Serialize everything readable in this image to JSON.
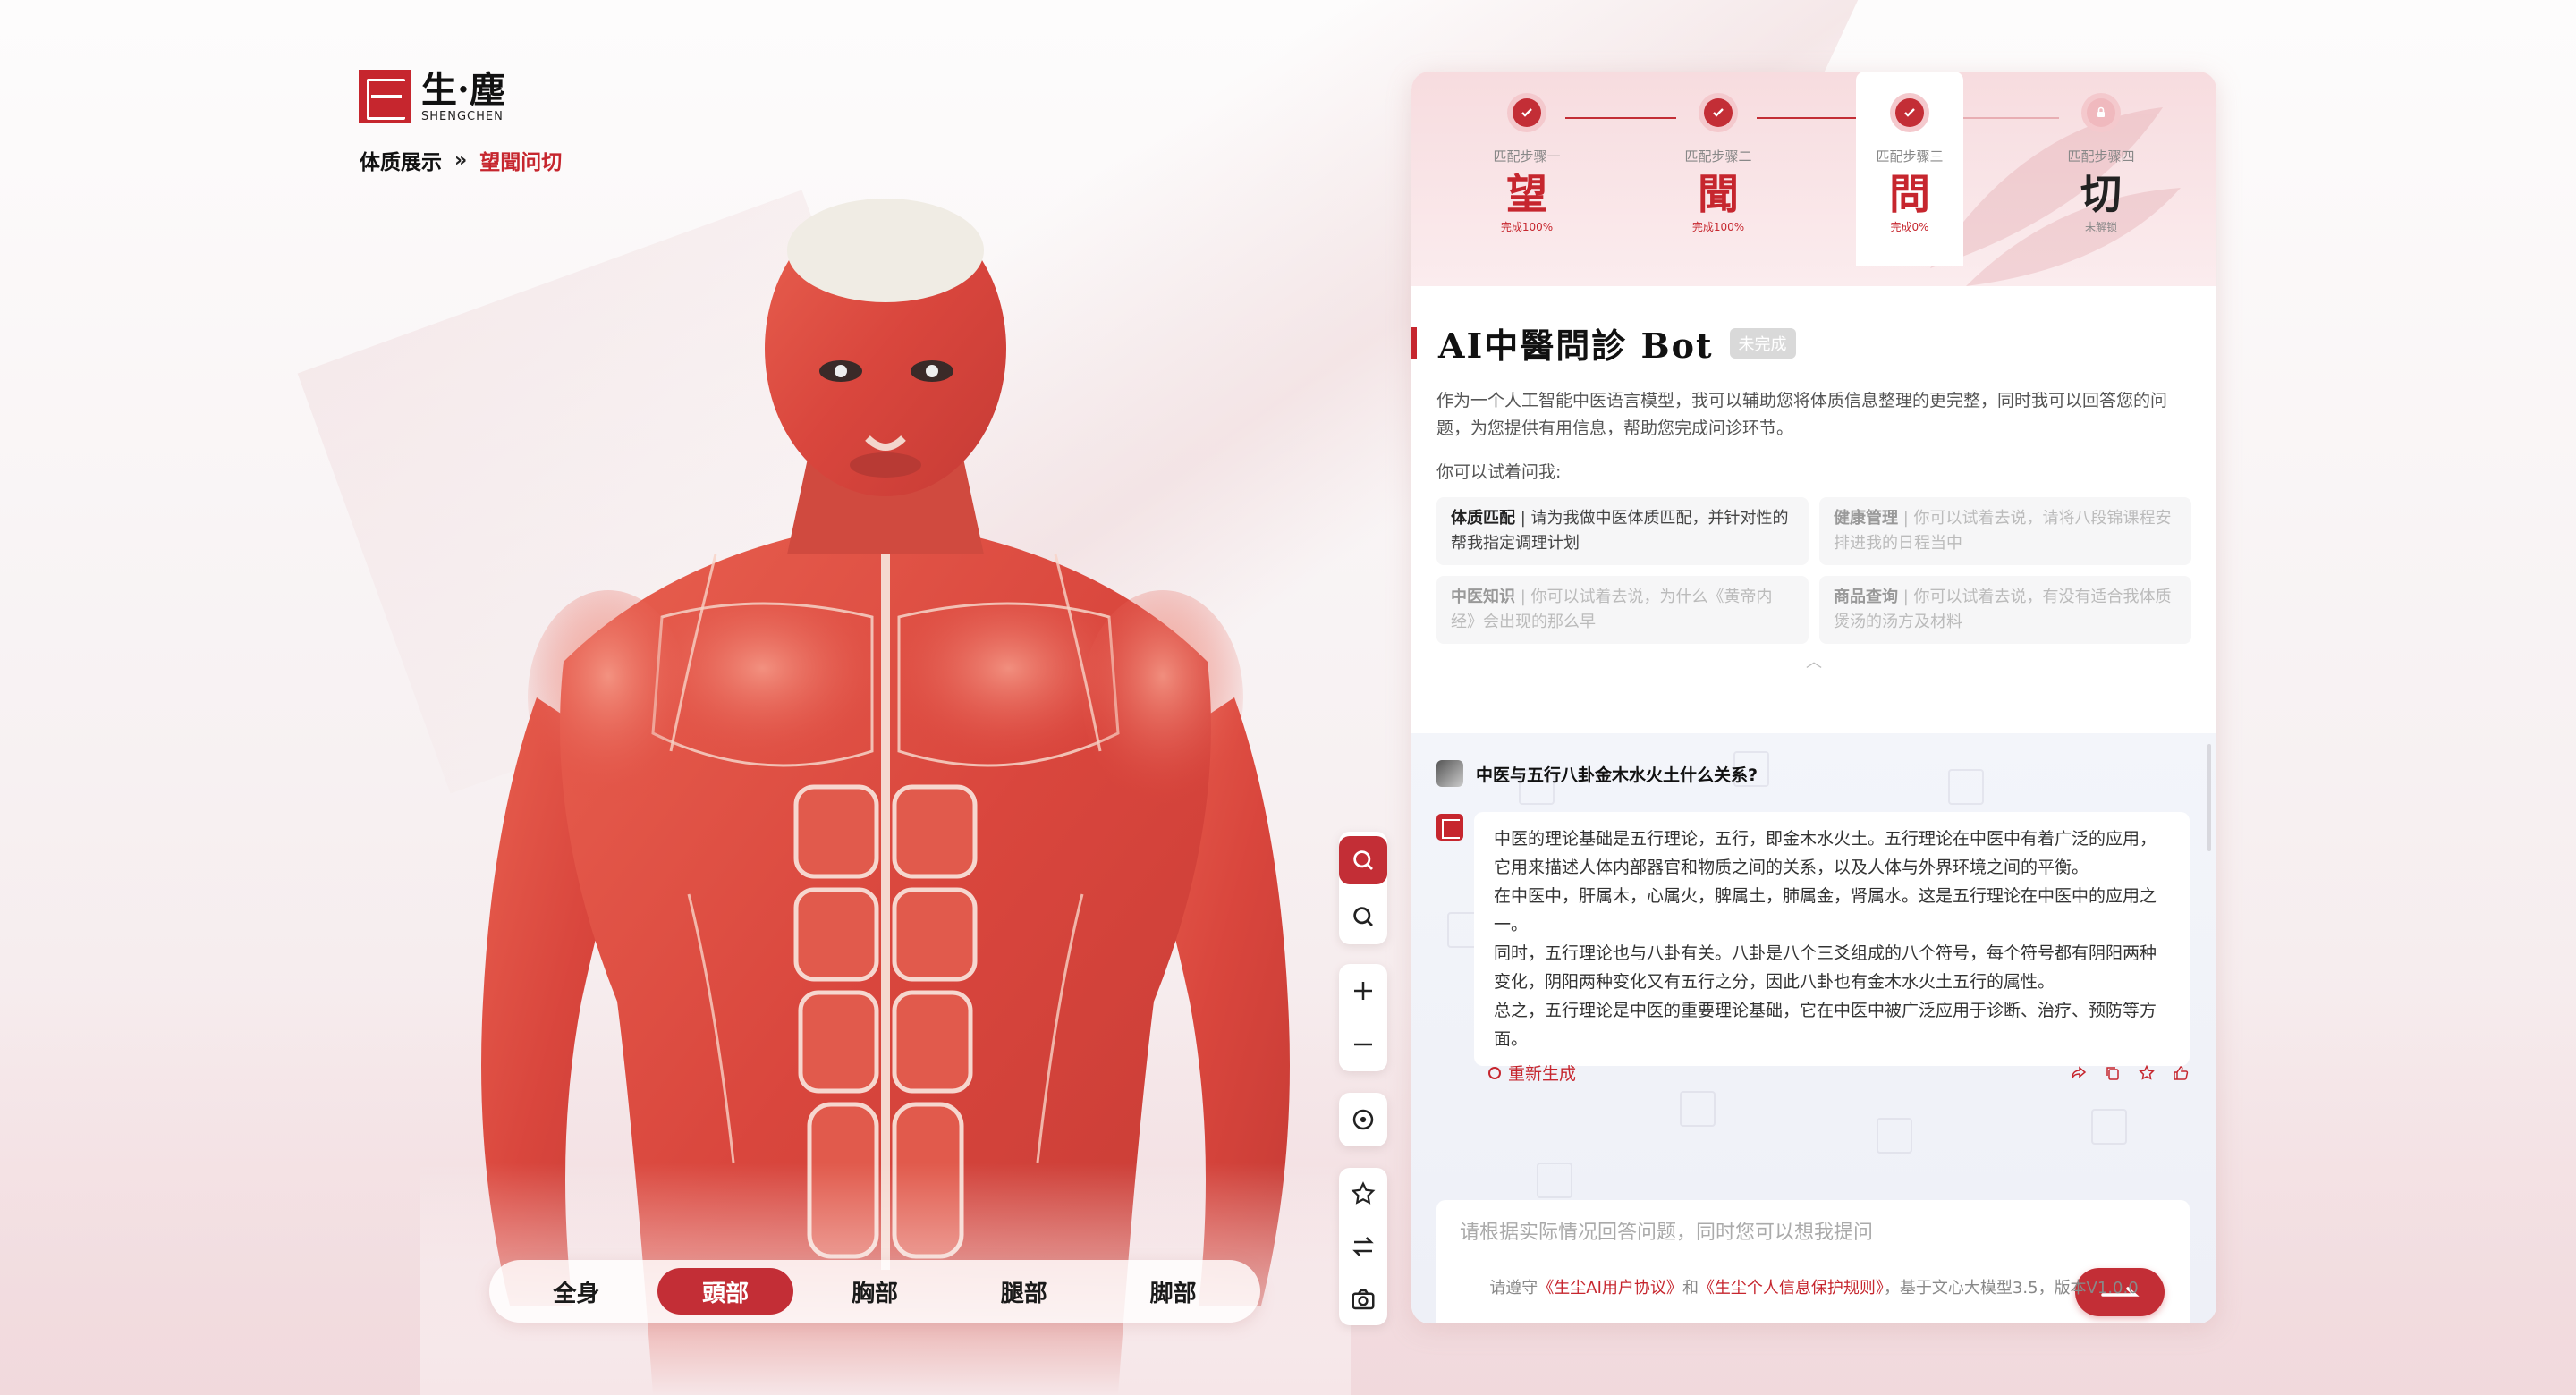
{
  "brand": {
    "name_cn": "生·塵",
    "name_en": "SHENGCHEN"
  },
  "breadcrumb": {
    "root": "体质展示",
    "separator": "»",
    "current": "望聞问切"
  },
  "body_tabs": [
    {
      "label": "全身",
      "active": false
    },
    {
      "label": "頭部",
      "active": true
    },
    {
      "label": "胸部",
      "active": false
    },
    {
      "label": "腿部",
      "active": false
    },
    {
      "label": "脚部",
      "active": false
    }
  ],
  "tools": [
    "search-active-icon",
    "search-icon",
    "zoom-in-icon",
    "zoom-out-icon",
    "target-icon",
    "star-icon",
    "swap-icon",
    "camera-icon"
  ],
  "steps": [
    {
      "label": "匹配步骤一",
      "glyph": "望",
      "status": "完成100%",
      "done": true
    },
    {
      "label": "匹配步骤二",
      "glyph": "聞",
      "status": "完成100%",
      "done": true
    },
    {
      "label": "匹配步骤三",
      "glyph": "問",
      "status": "完成0%",
      "done": true
    },
    {
      "label": "匹配步骤四",
      "glyph": "切",
      "status": "未解锁",
      "done": false
    }
  ],
  "bot": {
    "title": "AI中醫問診 Bot",
    "badge": "未完成",
    "description": "作为一个人工智能中医语言模型，我可以辅助您将体质信息整理的更完整，同时我可以回答您的问题，为您提供有用信息，帮助您完成问诊环节。",
    "try_label": "你可以试着问我:",
    "suggestions": [
      {
        "tag": "体质匹配",
        "text": "请为我做中医体质匹配，并针对性的帮我指定调理计划",
        "active": true
      },
      {
        "tag": "健康管理",
        "text": "你可以试着去说，请将八段锦课程安排进我的日程当中",
        "active": false
      },
      {
        "tag": "中医知识",
        "text": "你可以试着去说，为什么《黄帝内经》会出现的那么早",
        "active": false
      },
      {
        "tag": "商品查询",
        "text": "你可以试着去说，有没有适合我体质煲汤的汤方及材料",
        "active": false
      }
    ]
  },
  "chat": {
    "user_question": "中医与五行八卦金木水火土什么关系?",
    "answer": [
      "中医的理论基础是五行理论，五行，即金木水火土。五行理论在中医中有着广泛的应用，它用来描述人体内部器官和物质之间的关系，以及人体与外界环境之间的平衡。",
      "在中医中，肝属木，心属火，脾属土，肺属金，肾属水。这是五行理论在中医中的应用之一。",
      "同时，五行理论也与八卦有关。八卦是八个三爻组成的八个符号，每个符号都有阴阳两种变化，阴阳两种变化又有五行之分，因此八卦也有金木水火土五行的属性。",
      "总之，五行理论是中医的重要理论基础，它在中医中被广泛应用于诊断、治疗、预防等方面。"
    ],
    "regenerate_label": "重新生成",
    "input_placeholder": "请根据实际情况回答问题，同时您可以想我提问"
  },
  "footer": {
    "prefix": "请遵守",
    "link1": "《生尘AI用户协议》",
    "and": "和",
    "link2": "《生尘个人信息保护规则》",
    "suffix": "，基于文心大模型3.5，版本V1.0.0"
  },
  "colors": {
    "accent": "#c32e36",
    "brand_red": "#c6262e"
  }
}
